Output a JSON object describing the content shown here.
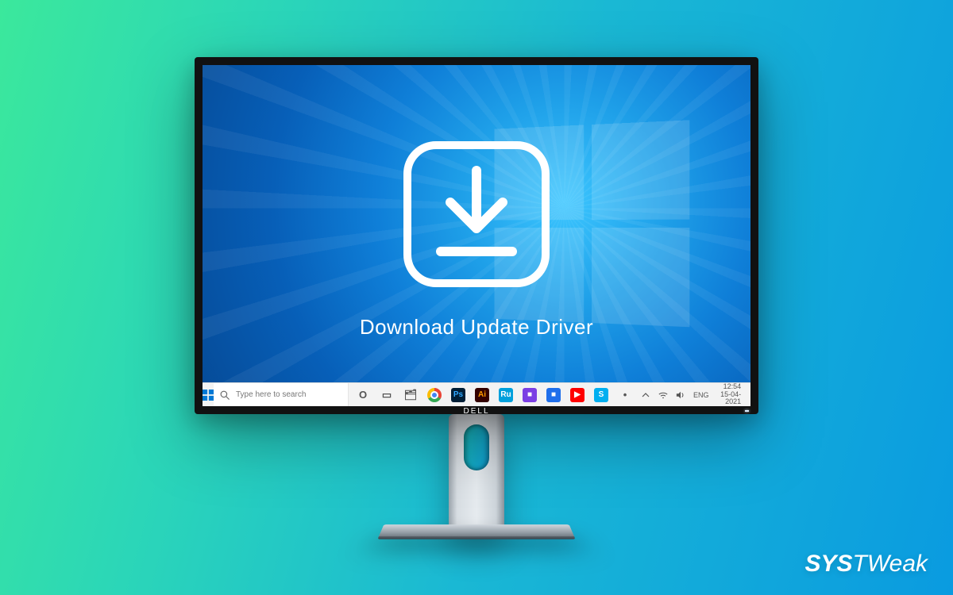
{
  "caption": "Download Update Driver",
  "monitor_brand": "DELL",
  "watermark": {
    "part1": "SYS",
    "part2": "TWeak"
  },
  "taskbar": {
    "search_placeholder": "Type here to search",
    "apps": [
      {
        "name": "cortana",
        "label": "O",
        "bg": "transparent",
        "fg": "#555"
      },
      {
        "name": "task-view",
        "label": "▭",
        "bg": "transparent",
        "fg": "#555"
      },
      {
        "name": "file-explorer",
        "label": "🗂",
        "bg": "transparent",
        "fg": ""
      },
      {
        "name": "chrome",
        "label": "",
        "bg": "chrome",
        "fg": ""
      },
      {
        "name": "photoshop",
        "label": "Ps",
        "bg": "#001e36",
        "fg": "#31a8ff"
      },
      {
        "name": "illustrator",
        "label": "Ai",
        "bg": "#330000",
        "fg": "#ff9a00"
      },
      {
        "name": "premiere-rush",
        "label": "Ru",
        "bg": "#00a0dc",
        "fg": "#ffffff"
      },
      {
        "name": "app-purple",
        "label": "■",
        "bg": "#7b3fe4",
        "fg": "#ffffff"
      },
      {
        "name": "app-blue",
        "label": "■",
        "bg": "#1f6feb",
        "fg": "#ffffff"
      },
      {
        "name": "youtube",
        "label": "▶",
        "bg": "#ff0000",
        "fg": "#ffffff"
      },
      {
        "name": "skype",
        "label": "S",
        "bg": "#00aff0",
        "fg": "#ffffff"
      },
      {
        "name": "app-misc",
        "label": "•",
        "bg": "transparent",
        "fg": "#555"
      }
    ],
    "tray": {
      "lang": "ENG",
      "time": "12:54",
      "date": "15-04-2021"
    }
  },
  "colors": {
    "screen_glow": "#2bb1f0"
  }
}
